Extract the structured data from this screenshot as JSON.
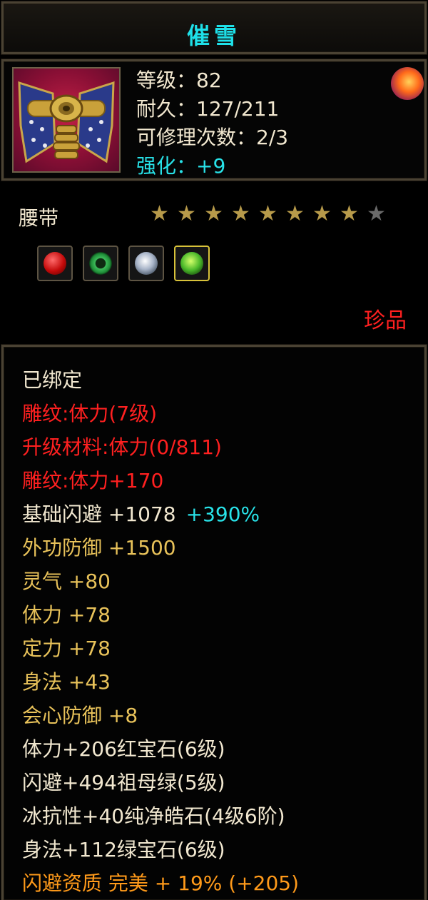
{
  "title": "催雪",
  "item": {
    "icon": "belt-icon",
    "rarity_icon": "flame-orb-icon",
    "stats": [
      {
        "label": "等级：82"
      },
      {
        "label": "耐久：127/211"
      },
      {
        "label": "可修理次数：2/3"
      },
      {
        "label": "强化：+9"
      }
    ],
    "type": "腰带",
    "stars_filled": 8,
    "stars_total": 9,
    "gems": [
      "red-gem-icon",
      "green-jade-ring-icon",
      "diamond-icon",
      "green-gem-icon"
    ],
    "rarity": "珍品"
  },
  "attributes": {
    "bound": "已绑定",
    "engrave_1": "雕纹:体力(7级)",
    "upgrade_material": "升级材料:体力(0/811)",
    "engrave_2": "雕纹:体力+170",
    "dodge_base": "基础闪避  +1078",
    "dodge_bonus": "+390%",
    "outer_defense": "外功防御  +1500",
    "spirit": "灵气  +80",
    "stamina": "体力  +78",
    "focus": "定力  +78",
    "agility": "身法  +43",
    "crit_defense": "会心防御  +8",
    "gem_1": "体力+206红宝石(6级)",
    "gem_2": "闪避+494祖母绿(5级)",
    "gem_3": "冰抗性+40纯净皓石(4级6阶)",
    "gem_4": "身法+112绿宝石(6级)",
    "quality": "闪避资质  完美  + 19%  (+205)"
  },
  "colors": {
    "title": "#1ee0e8",
    "star_filled": "#b79a4a",
    "star_empty": "#6a6a6a",
    "rarity": "#ff2020"
  }
}
